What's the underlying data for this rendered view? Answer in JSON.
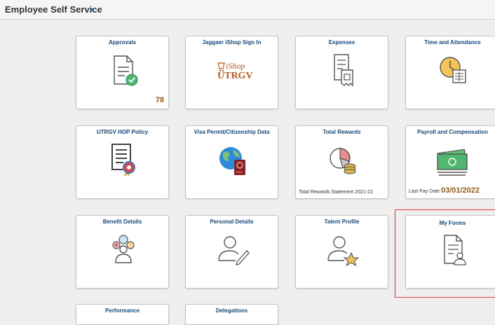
{
  "header": {
    "title": "Employee Self Service",
    "caret": "▼"
  },
  "tiles": [
    {
      "title": "Approvals",
      "icon": "document-check-icon",
      "count": "78"
    },
    {
      "title": "Jaggaer iShop Sign In",
      "icon": "ishop-utrgv-logo",
      "logo_ishop": "iShop",
      "logo_utrgv": "UTRGV"
    },
    {
      "title": "Expenses",
      "icon": "receipt-icon"
    },
    {
      "title": "Time and Attendance",
      "icon": "clock-calendar-icon"
    },
    {
      "title": "UTRGV HOP Policy",
      "icon": "policy-document-icon"
    },
    {
      "title": "Visa Permit/Citizenship Data",
      "icon": "globe-passport-icon",
      "passport_text": "PASS"
    },
    {
      "title": "Total Rewards",
      "icon": "pie-coins-icon",
      "footer": "Total Rewards Statement 2021-22"
    },
    {
      "title": "Payroll and Compensation",
      "icon": "money-icon",
      "footer_label": "Last Pay Date",
      "footer_date": "03/01/2022"
    },
    {
      "title": "Benefit Details",
      "icon": "benefits-people-icon"
    },
    {
      "title": "Personal Details",
      "icon": "person-pencil-icon"
    },
    {
      "title": "Talent Profile",
      "icon": "person-star-icon"
    },
    {
      "title": "My Forms",
      "icon": "form-person-icon"
    },
    {
      "title": "Performance",
      "icon": ""
    },
    {
      "title": "Delegations",
      "icon": ""
    }
  ],
  "colors": {
    "tile_title": "#134a82",
    "count": "#9a5b12",
    "highlight_border": "#e03b3b",
    "accent_green": "#4fb76f",
    "accent_blue": "#1f74c8"
  }
}
